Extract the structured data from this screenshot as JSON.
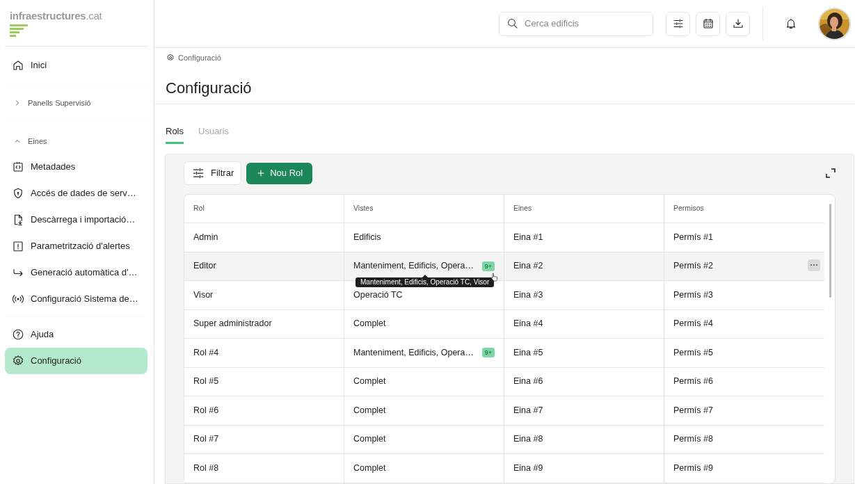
{
  "logo": {
    "name": "infraestructures",
    "suffix": ".cat"
  },
  "sidebar": {
    "top": [
      {
        "label": "Inici",
        "selected": false
      }
    ],
    "groups": [
      {
        "label": "Panells Supervisió",
        "expanded": false
      },
      {
        "label": "Eines",
        "expanded": true,
        "items": [
          {
            "label": "Metadades",
            "selected": false
          },
          {
            "label": "Accés de dades de serv…",
            "selected": false
          },
          {
            "label": "Descàrrega i importació…",
            "selected": false
          },
          {
            "label": "Parametrització d'alertes",
            "selected": false
          },
          {
            "label": "Generació automàtica d'…",
            "selected": false
          },
          {
            "label": "Configuració Sistema de…",
            "selected": false
          }
        ]
      }
    ],
    "bottom": [
      {
        "label": "Ajuda",
        "selected": false
      },
      {
        "label": "Configuració",
        "selected": true
      }
    ]
  },
  "header": {
    "search": {
      "placeholder": "Cerca edificis"
    }
  },
  "breadcrumb": "Configuració",
  "title": "Configuració",
  "tabs": [
    {
      "label": "Rols",
      "selected": true
    },
    {
      "label": "Usuaris",
      "selected": false
    }
  ],
  "toolbar": {
    "filter_button": "Filtrar",
    "add_button": "Nou Rol"
  },
  "table": {
    "columns": [
      "Rol",
      "Vistes",
      "Eines",
      "Permisos"
    ],
    "rows": [
      {
        "hovered": false,
        "cells": [
          {
            "text": "Admin"
          },
          {
            "text": "Edificis"
          },
          {
            "text": "Eina #1"
          },
          {
            "text": "Permís #1"
          }
        ]
      },
      {
        "hovered": true,
        "cells": [
          {
            "text": "Editor"
          },
          {
            "text": "Manteniment, Edificis, Opera…",
            "badge": "9+",
            "tooltip": "Manteniment, Edificis, Operació TC, Visor"
          },
          {
            "text": "Eina #2"
          },
          {
            "text": "Permís #2"
          }
        ]
      },
      {
        "hovered": false,
        "cells": [
          {
            "text": "Visor"
          },
          {
            "text": "Operació TC"
          },
          {
            "text": "Eina #3"
          },
          {
            "text": "Permís #3"
          }
        ]
      },
      {
        "hovered": false,
        "cells": [
          {
            "text": "Super administrador"
          },
          {
            "text": "Complet"
          },
          {
            "text": "Eina #4"
          },
          {
            "text": "Permís #4"
          }
        ]
      },
      {
        "hovered": false,
        "cells": [
          {
            "text": "Rol #4"
          },
          {
            "text": "Manteniment, Edificis, Opera…",
            "badge": "9+"
          },
          {
            "text": "Eina #5"
          },
          {
            "text": "Permís #5"
          }
        ]
      },
      {
        "hovered": false,
        "cells": [
          {
            "text": "Rol #5"
          },
          {
            "text": "Complet"
          },
          {
            "text": "Eina #6"
          },
          {
            "text": "Permís #6"
          }
        ]
      },
      {
        "hovered": false,
        "cells": [
          {
            "text": "Rol #6"
          },
          {
            "text": "Complet"
          },
          {
            "text": "Eina #7"
          },
          {
            "text": "Permís #7"
          }
        ]
      },
      {
        "hovered": false,
        "cells": [
          {
            "text": "Rol #7"
          },
          {
            "text": "Complet"
          },
          {
            "text": "Eina #8"
          },
          {
            "text": "Permís #8"
          }
        ]
      },
      {
        "hovered": false,
        "cells": [
          {
            "text": "Rol #8"
          },
          {
            "text": "Complet"
          },
          {
            "text": "Eina #9"
          },
          {
            "text": "Permís #9"
          }
        ]
      }
    ]
  }
}
